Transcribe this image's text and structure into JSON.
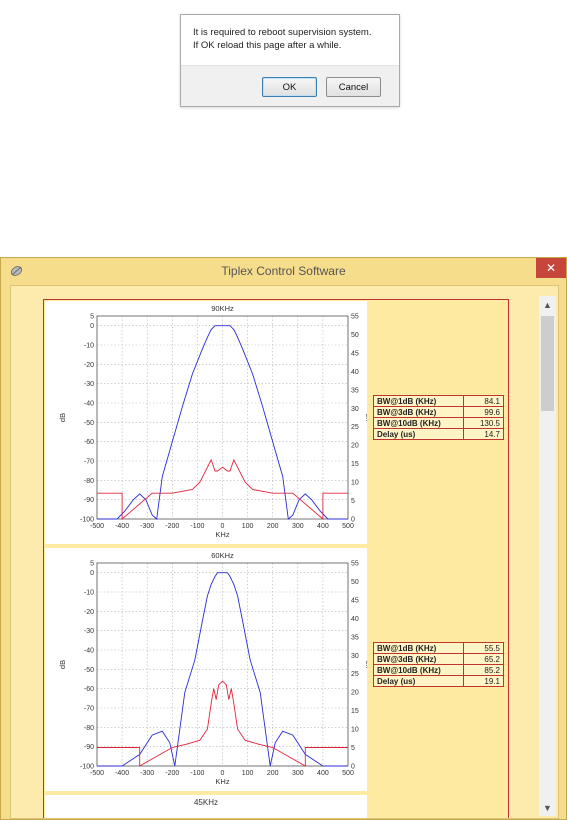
{
  "dialog": {
    "message_line1": "It is required to reboot supervision system.",
    "message_line2": "If OK reload this page after a while.",
    "ok_label": "OK",
    "cancel_label": "Cancel"
  },
  "window": {
    "title": "Tiplex Control Software",
    "close_glyph": "✕",
    "scroll_up_glyph": "▲",
    "scroll_down_glyph": "▼"
  },
  "colors": {
    "window_bg": "#f6dd8b",
    "panel_border": "#c0342b",
    "response_line": "#2b2bd6",
    "delay_line": "#e0243d",
    "close_button": "#c7463b"
  },
  "chart_data": [
    {
      "type": "line",
      "title": "90KHz",
      "xlabel": "KHz",
      "ylabel": "dB",
      "y2label": "us",
      "xlim": [
        -500,
        500
      ],
      "ylim": [
        -100,
        5
      ],
      "y2lim": [
        0,
        55
      ],
      "xticks": [
        "-500",
        "-400",
        "-300",
        "-200",
        "-100",
        "0",
        "100",
        "200",
        "300",
        "400",
        "500"
      ],
      "yticks": [
        "5",
        "0",
        "-10",
        "-20",
        "-30",
        "-40",
        "-50",
        "-60",
        "-70",
        "-80",
        "-90",
        "-100"
      ],
      "y2ticks": [
        "55",
        "50",
        "45",
        "40",
        "35",
        "30",
        "25",
        "20",
        "15",
        "10",
        "5",
        "0"
      ],
      "grid": true,
      "series": [
        {
          "axis": "left",
          "color": "#2b2bd6",
          "x": [
            -500,
            -420,
            -390,
            -355,
            -330,
            -305,
            -280,
            -262,
            -240,
            -200,
            -160,
            -120,
            -80,
            -60,
            -45,
            -30,
            -20,
            20,
            30,
            45,
            60,
            80,
            120,
            160,
            200,
            240,
            262,
            280,
            305,
            330,
            355,
            390,
            420,
            500
          ],
          "y": [
            -100,
            -100,
            -96,
            -90,
            -87,
            -90,
            -98,
            -100,
            -78,
            -60,
            -42,
            -25,
            -12,
            -6,
            -2,
            0,
            0,
            0,
            0,
            -2,
            -6,
            -12,
            -25,
            -42,
            -60,
            -78,
            -100,
            -98,
            -90,
            -87,
            -90,
            -96,
            -100,
            -100
          ]
        },
        {
          "axis": "right",
          "color": "#e0243d",
          "x": [
            -500,
            -400,
            -400,
            -280,
            -200,
            -120,
            -90,
            -60,
            -45,
            -30,
            -20,
            0,
            20,
            30,
            45,
            60,
            90,
            120,
            200,
            280,
            400,
            400,
            500
          ],
          "y": [
            7,
            7,
            0,
            7,
            7,
            8,
            10,
            14,
            16,
            13,
            13,
            14,
            13,
            13,
            16,
            14,
            10,
            8,
            7,
            7,
            0,
            7,
            7
          ]
        }
      ]
    },
    {
      "type": "line",
      "title": "60KHz",
      "xlabel": "KHz",
      "ylabel": "dB",
      "y2label": "us",
      "xlim": [
        -500,
        500
      ],
      "ylim": [
        -100,
        5
      ],
      "y2lim": [
        0,
        55
      ],
      "xticks": [
        "-500",
        "-400",
        "-300",
        "-200",
        "-100",
        "0",
        "100",
        "200",
        "300",
        "400",
        "500"
      ],
      "yticks": [
        "5",
        "0",
        "-10",
        "-20",
        "-30",
        "-40",
        "-50",
        "-60",
        "-70",
        "-80",
        "-90",
        "-100"
      ],
      "y2ticks": [
        "55",
        "50",
        "45",
        "40",
        "35",
        "30",
        "25",
        "20",
        "15",
        "10",
        "5",
        "0"
      ],
      "grid": true,
      "series": [
        {
          "axis": "left",
          "color": "#2b2bd6",
          "x": [
            -500,
            -400,
            -330,
            -280,
            -240,
            -210,
            -190,
            -150,
            -110,
            -80,
            -60,
            -45,
            -30,
            -20,
            20,
            30,
            45,
            60,
            80,
            110,
            150,
            190,
            210,
            240,
            280,
            330,
            400,
            500
          ],
          "y": [
            -100,
            -100,
            -94,
            -84,
            -82,
            -88,
            -100,
            -62,
            -45,
            -25,
            -12,
            -6,
            -2,
            0,
            0,
            -2,
            -6,
            -12,
            -25,
            -45,
            -62,
            -100,
            -88,
            -82,
            -84,
            -94,
            -100,
            -100
          ]
        },
        {
          "axis": "right",
          "color": "#e0243d",
          "x": [
            -500,
            -330,
            -330,
            -200,
            -140,
            -90,
            -60,
            -45,
            -35,
            -25,
            -15,
            0,
            15,
            25,
            35,
            45,
            60,
            90,
            140,
            200,
            330,
            330,
            500
          ],
          "y": [
            5,
            5,
            0,
            5,
            6,
            7,
            10,
            17,
            21,
            18,
            22,
            23,
            22,
            18,
            21,
            17,
            10,
            7,
            6,
            5,
            0,
            5,
            5
          ]
        }
      ]
    }
  ],
  "panel3": {
    "title": "45KHz"
  },
  "tables": [
    {
      "rows": [
        {
          "label": "BW@1dB (KHz)",
          "value": "84.1"
        },
        {
          "label": "BW@3dB (KHz)",
          "value": "99.6"
        },
        {
          "label": "BW@10dB (KHz)",
          "value": "130.5"
        },
        {
          "label": "Delay (us)",
          "value": "14.7"
        }
      ]
    },
    {
      "rows": [
        {
          "label": "BW@1dB (KHz)",
          "value": "55.5"
        },
        {
          "label": "BW@3dB (KHz)",
          "value": "65.2"
        },
        {
          "label": "BW@10dB (KHz)",
          "value": "85.2"
        },
        {
          "label": "Delay (us)",
          "value": "19.1"
        }
      ]
    }
  ]
}
